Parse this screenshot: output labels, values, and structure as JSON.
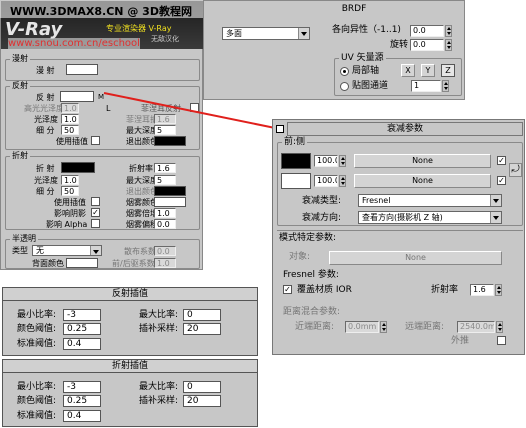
{
  "watermark": {
    "line1": "WWW.3DMAX8.CN @ 3D教程网",
    "line2": "www.snou.com.cn/eschool",
    "logo_text": "V-Ray",
    "vray_text": "专业渲染器 V-Ray",
    "vray_sub": "无敌汉化"
  },
  "top_right": {
    "title": "BRDF",
    "type_value": "多面",
    "aniso_label": "各向异性（-1..1)",
    "aniso_value": "0.0",
    "rotation_label": "旋转",
    "rotation_value": "0.0",
    "uv_group": "UV 矢量源",
    "local_axis": "局部轴",
    "axis_x": "X",
    "axis_y": "Y",
    "axis_z": "Z",
    "map_channel": "贴图通道",
    "map_channel_value": "1"
  },
  "left": {
    "diffuse_group": "漫射",
    "diffuse_label": "漫 射",
    "reflect_group": "反射",
    "reflect_label": "反 射",
    "reflect_m": "M",
    "fresnel_label": "菲涅耳反射",
    "hilight_label": "高光光泽度",
    "hilight_value": "1.0",
    "hilight_L": "L",
    "fresnel_ior_label": "菲涅耳折射率",
    "fresnel_ior_value": "1.6",
    "gloss_label": "光泽度",
    "gloss_value": "1.0",
    "subdiv_label": "细 分",
    "subdiv_value": "50",
    "max_depth_label": "最大深度",
    "max_depth_value": "5",
    "use_interp_label": "使用插值",
    "exit_color_label": "退出颜色",
    "refract_group": "折射",
    "refract_label": "折 射",
    "ior_label": "折射率",
    "ior_value": "1.6",
    "r_gloss_label": "光泽度",
    "r_gloss_value": "1.0",
    "r_max_depth_label": "最大深度",
    "r_max_depth_value": "5",
    "r_subdiv_label": "细 分",
    "r_subdiv_value": "50",
    "r_exit_label": "退出颜色",
    "r_use_interp": "使用插值",
    "fog_color": "烟雾颜色",
    "affect_shadow": "影响阴影",
    "fog_mult": "烟雾倍增",
    "fog_mult_value": "1.0",
    "affect_alpha": "影响 Alpha",
    "fog_bias": "烟雾偏移",
    "fog_bias_value": "0.0",
    "translucent_group": "半透明",
    "type_label": "类型",
    "type_value": "无",
    "scatter_label": "散布系数",
    "scatter_value": "0.0",
    "back_color": "背面颜色",
    "fb_label": "前/后驱系数",
    "fb_value": "1.0"
  },
  "attenuation": {
    "title": "衰减参数",
    "front_side": "前:侧",
    "val1": "100.0",
    "none1": "None",
    "val2": "100.0",
    "none2": "None",
    "falloff_type_label": "衰减类型:",
    "falloff_type_value": "Fresnel",
    "falloff_dir_label": "衰减方向:",
    "falloff_dir_value": "查看方向(摄影机 Z 轴)",
    "mode_group": "模式特定参数:",
    "object_label": "对象:",
    "object_value": "None",
    "fresnel_params": "Fresnel 参数:",
    "override_ior": "覆盖材质 IOR",
    "ior_label": "折射率",
    "ior_value": "1.6",
    "distance_group": "距离混合参数:",
    "near_label": "近端距离:",
    "near_value": "0.0mm",
    "far_label": "远端距离:",
    "far_value": "2540.0m",
    "extrapolate": "外推"
  },
  "reflect_interp": {
    "title": "反射插值",
    "min_rate": "最小比率:",
    "min_value": "-3",
    "max_rate": "最大比率:",
    "max_value": "0",
    "clr_thresh": "颜色阈值:",
    "clr_value": "0.25",
    "interp_samples": "插补采样:",
    "samples_value": "20",
    "norm_thresh": "标准阈值:",
    "norm_value": "0.4"
  },
  "refract_interp": {
    "title": "折射插值",
    "min_rate": "最小比率:",
    "min_value": "-3",
    "max_rate": "最大比率:",
    "max_value": "0",
    "clr_thresh": "颜色阈值:",
    "clr_value": "0.25",
    "interp_samples": "插补采样:",
    "samples_value": "20",
    "norm_thresh": "标准阈值:",
    "norm_value": "0.4"
  },
  "colors": {
    "arrow": "#e0201c",
    "panel": "#c7c7c7"
  }
}
